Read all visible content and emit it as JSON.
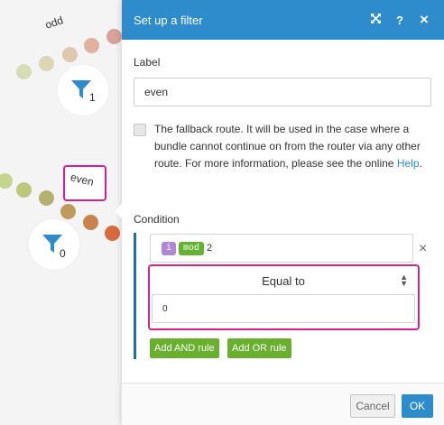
{
  "canvas": {
    "routes": {
      "odd_label": "odd",
      "even_label": "even"
    },
    "filters": [
      {
        "number": "1"
      },
      {
        "number": "0"
      }
    ],
    "colors": {
      "filter_icon": "#2e8ccc",
      "highlight": "#d6208f"
    }
  },
  "panel": {
    "title": "Set up a filter",
    "header_icons": [
      "expand-icon",
      "help-icon",
      "close-icon"
    ],
    "help_symbol": "?",
    "close_symbol": "×",
    "label_title": "Label",
    "label_value": "even",
    "fallback_text": "The fallback route. It will be used in the case where a bundle cannot continue on from the router via any other route. For more information, please see the online",
    "fallback_link": "Help",
    "fallback_period": ".",
    "fallback_checked": false,
    "condition_title": "Condition",
    "condition": {
      "operand_variable": "i",
      "operand_function": "mod",
      "operand_argument": "2",
      "operator": "Equal to",
      "value": "0",
      "remove_symbol": "×"
    },
    "add_and_rule": "Add AND rule",
    "add_or_rule": "Add OR rule",
    "cancel_label": "Cancel",
    "ok_label": "OK",
    "colors": {
      "header": "#2e8ccc",
      "green_button": "#6ab02f",
      "variable_pill": "#b086d8",
      "function_pill": "#63b332"
    }
  }
}
